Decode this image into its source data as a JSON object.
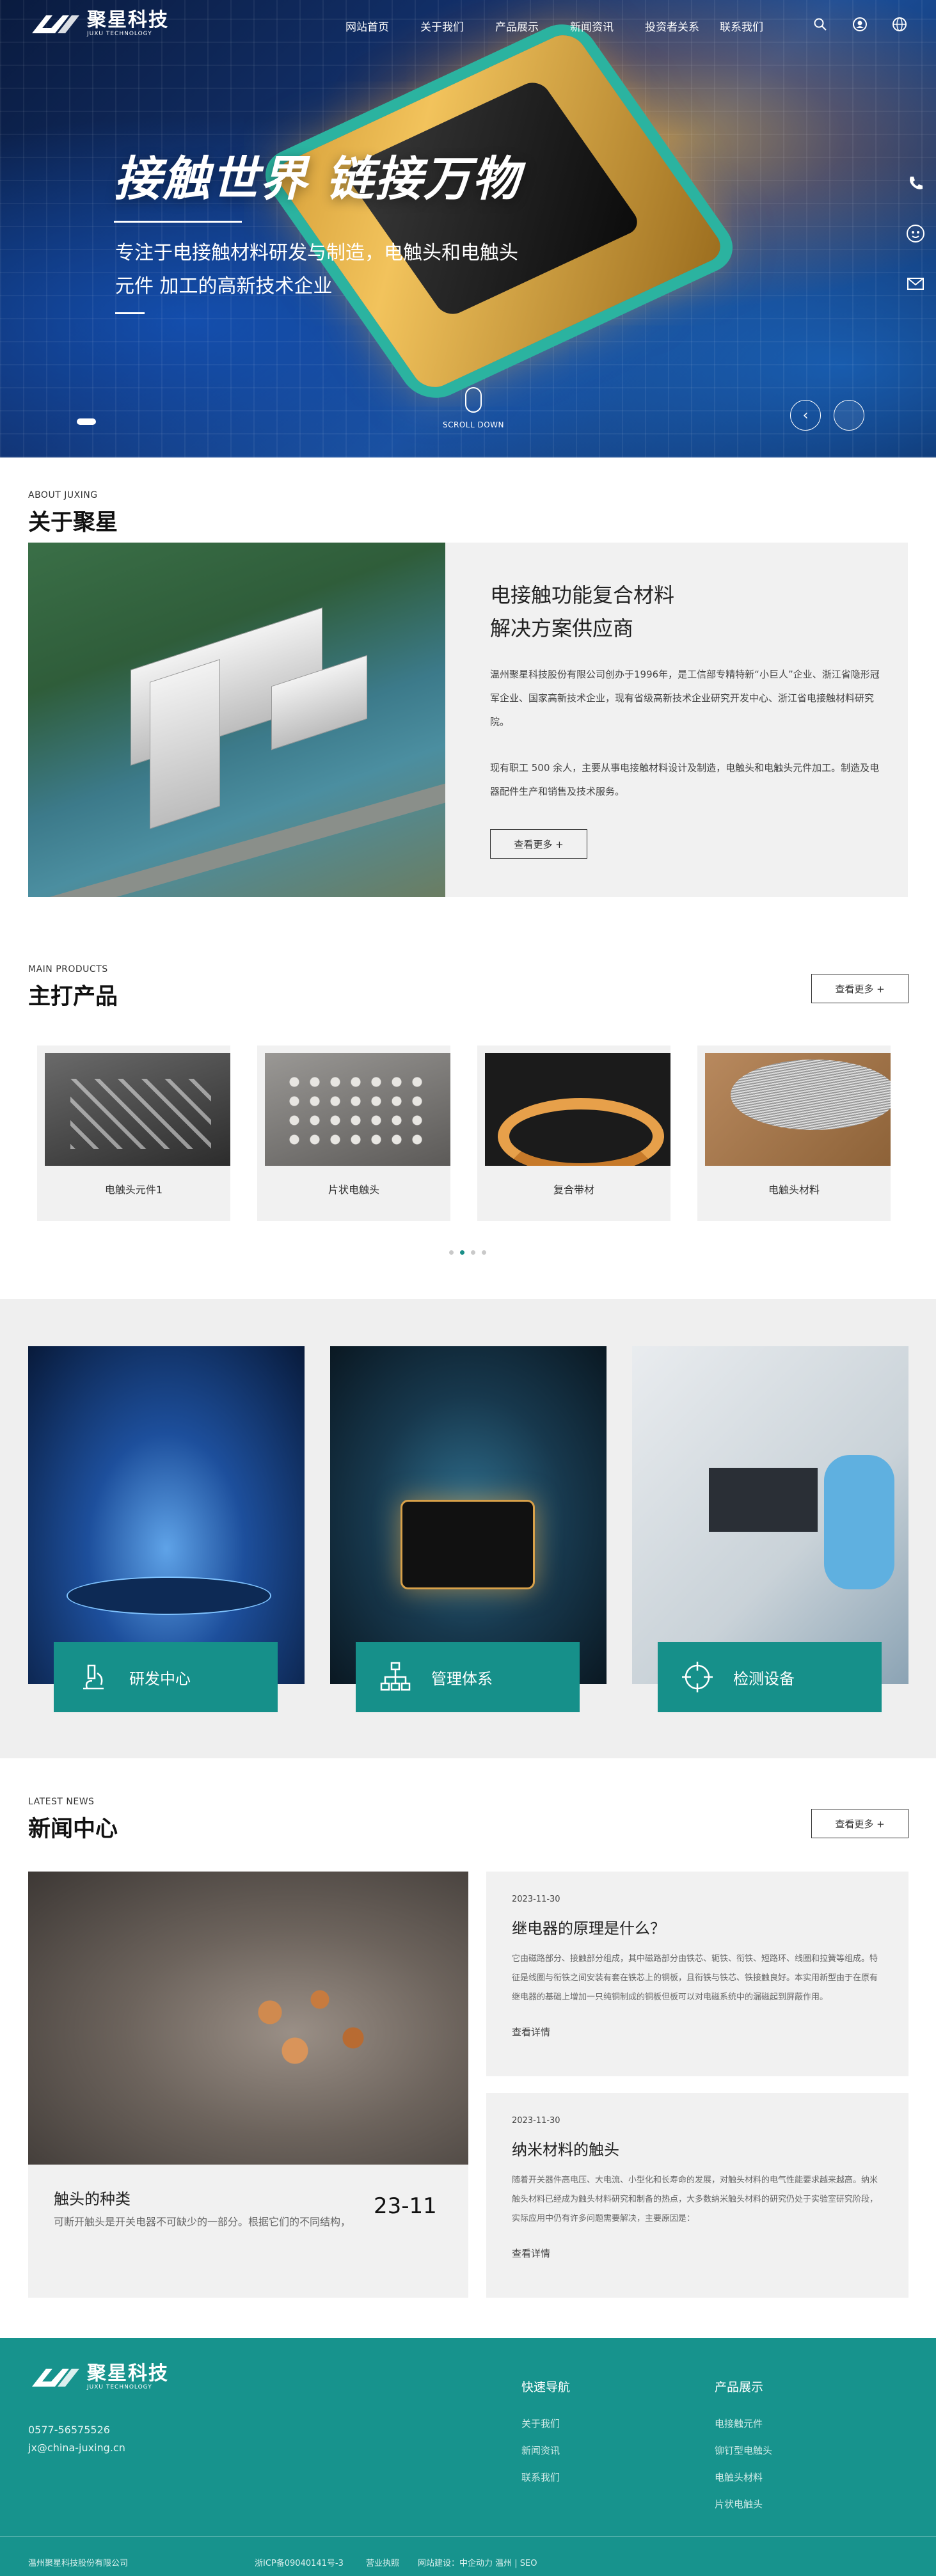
{
  "header": {
    "logo_text": "聚星科技",
    "logo_en": "JUXU TECHNOLOGY",
    "menu": [
      "网站首页",
      "关于我们",
      "产品展示",
      "新闻资讯",
      "投资者关系",
      "联系我们"
    ]
  },
  "hero": {
    "slogan": "接触世界 链接万物",
    "subtitle_line1": "专注于电接触材料研发与制造，电触头和电触头",
    "subtitle_line2": "元件 加工的高新技术企业",
    "scroll_label": "SCROLL DOWN"
  },
  "about": {
    "en": "ABOUT JUXING",
    "cn": "关于聚星",
    "title_line1": "电接触功能复合材料",
    "title_line2": "解决方案供应商",
    "para1": "温州聚星科技股份有限公司创办于1996年，是工信部专精特新“小巨人”企业、浙江省隐形冠军企业、国家高新技术企业，现有省级高新技术企业研究开发中心、浙江省电接触材料研究院。",
    "para2": "现有职工 500 余人，主要从事电接触材料设计及制造，电触头和电触头元件加工。制造及电器配件生产和销售及技术服务。",
    "more": "查看更多 +"
  },
  "products": {
    "en": "MAIN PRODUCTS",
    "cn": "主打产品",
    "more": "查看更多 +",
    "items": [
      {
        "name": "电触头元件1"
      },
      {
        "name": "片状电触头"
      },
      {
        "name": "复合带材"
      },
      {
        "name": "电触头材料"
      }
    ]
  },
  "capabilities": [
    {
      "label": "研发中心",
      "icon": "microscope-icon"
    },
    {
      "label": "管理体系",
      "icon": "org-chart-icon"
    },
    {
      "label": "检测设备",
      "icon": "crosshair-icon"
    }
  ],
  "news": {
    "en": "LATEST NEWS",
    "cn": "新闻中心",
    "more": "查看更多 +",
    "featured": {
      "title": "触头的种类",
      "desc": "可断开触头是开关电器不可缺少的一部分。根据它们的不同结构，",
      "date": "23-11"
    },
    "items": [
      {
        "date": "2023-11-30",
        "title": "继电器的原理是什么？",
        "desc": "它由磁路部分、接触部分组成，其中磁路部分由铁芯、轭铁、衔铁、短路环、线圈和拉簧等组成。特征是线圈与衔铁之间安装有套在铁芯上的铜板，且衔铁与铁芯、铁接触良好。本实用新型由于在原有继电器的基础上增加一只纯铜制成的铜板但板可以对电磁系统中的漏磁起到屏蔽作用。",
        "more": "查看详情"
      },
      {
        "date": "2023-11-30",
        "title": "纳米材料的触头",
        "desc": "随着开关器件高电压、大电流、小型化和长寿命的发展，对触头材料的电气性能要求越来越高。纳米触头材料已经成为触头材料研究和制备的热点，大多数纳米触头材料的研究仍处于实验室研究阶段，实际应用中仍有许多问题需要解决，主要原因是：",
        "more": "查看详情"
      }
    ]
  },
  "footer": {
    "logo_text": "聚星科技",
    "logo_en": "JUXU TECHNOLOGY",
    "phone": "0577-56575526",
    "email": "jx@china-juxing.cn",
    "nav_title": "快速导航",
    "nav": [
      "关于我们",
      "新闻资讯",
      "联系我们"
    ],
    "prod_title": "产品展示",
    "prod": [
      "电接触元件",
      "铆钉型电触头",
      "电触头材料",
      "片状电触头"
    ],
    "company": "温州聚星科技股份有限公司",
    "icp": "浙ICP备09040141号-3",
    "license": "营业执照",
    "build": "网站建设：中企动力 温州 | SEO"
  },
  "colors": {
    "accent": "#17938d",
    "dark": "#222222"
  }
}
